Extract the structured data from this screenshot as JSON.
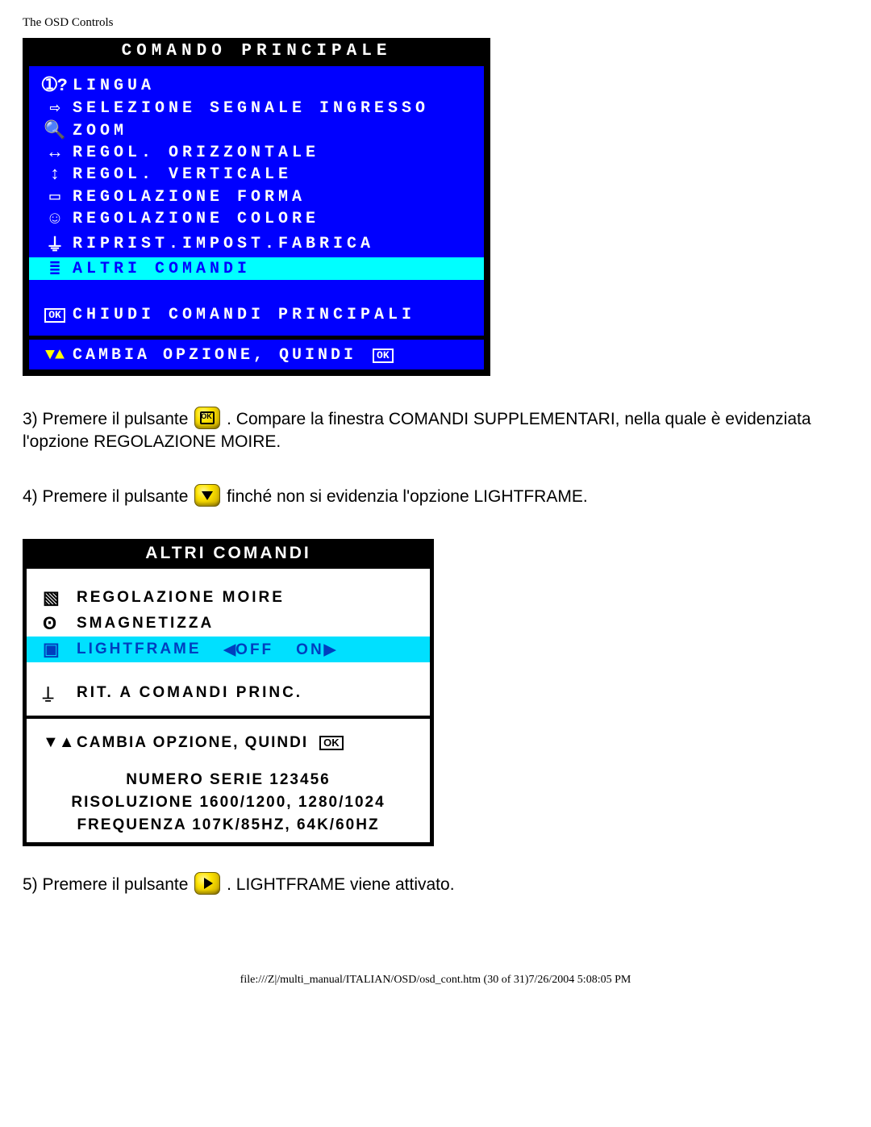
{
  "header": {
    "title": "The OSD Controls"
  },
  "osd1": {
    "title": "COMANDO PRINCIPALE",
    "items": [
      {
        "icon": "➀?",
        "label": "LINGUA"
      },
      {
        "icon": "⇨",
        "label": "SELEZIONE SEGNALE INGRESSO"
      },
      {
        "icon": "🔍",
        "label": "ZOOM"
      },
      {
        "icon": "↔",
        "label": "REGOL. ORIZZONTALE"
      },
      {
        "icon": "↕",
        "label": "REGOL. VERTICALE"
      },
      {
        "icon": "▭",
        "label": "REGOLAZIONE FORMA"
      },
      {
        "icon": "☺",
        "label": "REGOLAZIONE COLORE"
      },
      {
        "icon": "⏚",
        "label": "RIPRIST.IMPOST.FABRICA"
      },
      {
        "icon": "≣",
        "label": "ALTRI COMANDI",
        "selected": true
      }
    ],
    "close": {
      "icon": "OK",
      "label": "CHIUDI COMANDI PRINCIPALI"
    },
    "footer": {
      "icon": "▼▲",
      "label": "CAMBIA OPZIONE, QUINDI",
      "trail": "OK"
    }
  },
  "step3": {
    "prefix": "3) Premere il pulsante ",
    "suffix": ". Compare la finestra COMANDI SUPPLEMENTARI, nella quale è evidenziata l'opzione REGOLAZIONE MOIRE."
  },
  "step4": {
    "prefix": "4) Premere il pulsante ",
    "suffix": " finché non si evidenzia l'opzione LIGHTFRAME."
  },
  "osd2": {
    "title": "ALTRI COMANDI",
    "items": [
      {
        "icon": "▧",
        "label": "REGOLAZIONE MOIRE"
      },
      {
        "icon": "ʘ",
        "label": "SMAGNETIZZA"
      },
      {
        "icon": "▣",
        "label": "LIGHTFRAME",
        "selected": true,
        "opt_off": "OFF",
        "opt_on": "ON"
      }
    ],
    "return": {
      "icon": "⍊",
      "label": "RIT. A COMANDI PRINC."
    },
    "footer": {
      "icon": "▼▲",
      "label": "CAMBIA OPZIONE, QUINDI",
      "trail": "OK"
    },
    "info1": "NUMERO SERIE 123456",
    "info2": "RISOLUZIONE 1600/1200, 1280/1024",
    "info3": "FREQUENZA 107K/85HZ, 64K/60HZ"
  },
  "step5": {
    "prefix": "5) Premere il pulsante ",
    "suffix": ". LIGHTFRAME viene attivato."
  },
  "footer": "file:///Z|/multi_manual/ITALIAN/OSD/osd_cont.htm (30 of 31)7/26/2004 5:08:05 PM"
}
